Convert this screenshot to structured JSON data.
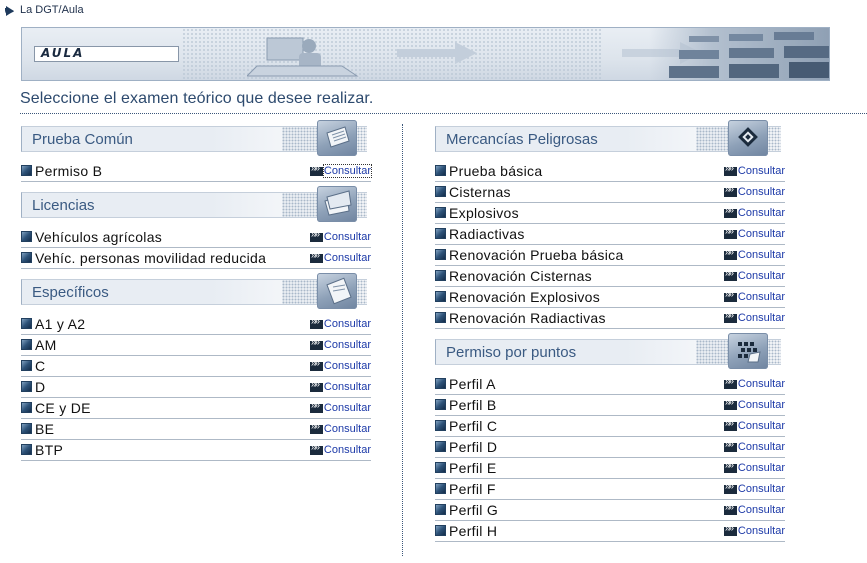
{
  "breadcrumb": {
    "label": "La DGT/Aula",
    "icon": "arrow-bullet-icon"
  },
  "banner": {
    "logo_text": "AULA"
  },
  "subtitle": "Seleccione el examen teórico que desee realizar.",
  "consult_label": "Consultar",
  "left_sections": [
    {
      "title": "Prueba Común",
      "icon": "papers-icon",
      "items": [
        "Permiso B"
      ]
    },
    {
      "title": "Licencias",
      "icon": "paper-stack-icon",
      "items": [
        "Vehículos agrícolas",
        "Vehíc. personas movilidad reducida"
      ]
    },
    {
      "title": "Específicos",
      "icon": "document-icon",
      "items": [
        "A1 y A2",
        "AM",
        "C",
        "D",
        "CE y DE",
        "BE",
        "BTP"
      ]
    }
  ],
  "right_sections": [
    {
      "title": "Mercancías Peligrosas",
      "icon": "hazard-sign-icon",
      "items": [
        "Prueba básica",
        "Cisternas",
        "Explosivos",
        "Radiactivas",
        "Renovación Prueba básica",
        "Renovación Cisternas",
        "Renovación Explosivos",
        "Renovación Radiactivas"
      ]
    },
    {
      "title": "Permiso por puntos",
      "icon": "points-grid-icon",
      "items": [
        "Perfil A",
        "Perfil B",
        "Perfil C",
        "Perfil D",
        "Perfil E",
        "Perfil F",
        "Perfil G",
        "Perfil H"
      ]
    }
  ],
  "colors": {
    "accent": "#3a5a82",
    "link": "#1d3aa8",
    "rule": "#aeb9c6"
  }
}
